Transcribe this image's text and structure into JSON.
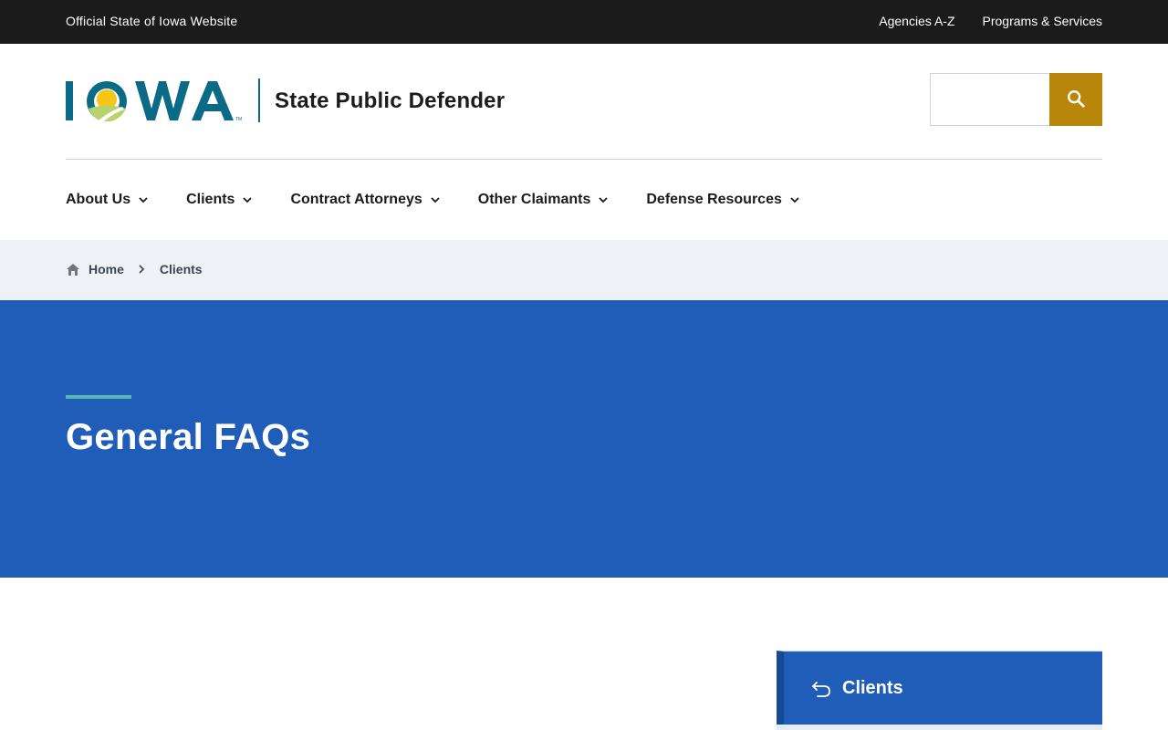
{
  "topbar": {
    "official_label": "Official State of Iowa Website",
    "links": [
      "Agencies A-Z",
      "Programs & Services"
    ]
  },
  "header": {
    "logo_text": "IOWA",
    "site_title": "State Public Defender",
    "search": {
      "placeholder": "",
      "button_icon": "search-icon"
    }
  },
  "nav": {
    "items": [
      {
        "label": "About Us"
      },
      {
        "label": "Clients"
      },
      {
        "label": "Contract Attorneys"
      },
      {
        "label": "Other Claimants"
      },
      {
        "label": "Defense Resources"
      }
    ]
  },
  "breadcrumb": {
    "items": [
      "Home",
      "Clients"
    ]
  },
  "hero": {
    "title": "General FAQs"
  },
  "sidebar": {
    "back_label": "Clients"
  },
  "colors": {
    "topbar_bg": "#1b1b1b",
    "brand_teal": "#0b6b86",
    "search_button": "#b8860b",
    "breadcrumb_bg": "#eef2f7",
    "hero_bg": "#1f5db8",
    "hero_accent": "#5bb8b0"
  }
}
